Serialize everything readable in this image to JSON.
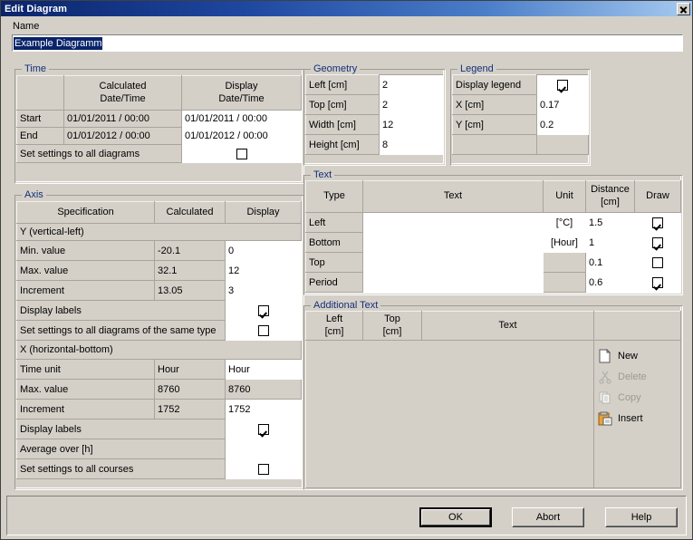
{
  "window": {
    "title": "Edit Diagram",
    "close_label": "✕"
  },
  "name": {
    "label": "Name",
    "value": "Example Diagramm"
  },
  "time": {
    "title": "Time",
    "headers": [
      "",
      "Calculated\nDate/Time",
      "Display\nDate/Time"
    ],
    "header_calculated_line1": "Calculated",
    "header_calculated_line2": "Date/Time",
    "header_display_line1": "Display",
    "header_display_line2": "Date/Time",
    "rows": [
      {
        "label": "Start",
        "calculated": "01/01/2011 / 00:00",
        "display": "01/01/2011 / 00:00"
      },
      {
        "label": "End",
        "calculated": "01/01/2012 / 00:00",
        "display": "01/01/2012 / 00:00"
      }
    ],
    "set_all_label": "Set settings to all diagrams",
    "set_all_checked": false
  },
  "axis": {
    "title": "Axis",
    "header_specification": "Specification",
    "header_calculated": "Calculated",
    "header_display": "Display",
    "y_section_label": "Y (vertical-left)",
    "y_rows": [
      {
        "label": "Min. value",
        "calculated": "-20.1",
        "display": "0"
      },
      {
        "label": "Max. value",
        "calculated": "32.1",
        "display": "12"
      },
      {
        "label": "Increment",
        "calculated": "13.05",
        "display": "3"
      }
    ],
    "y_display_labels_label": "Display labels",
    "y_display_labels_checked": true,
    "y_set_all_label": "Set settings to all diagrams of the same type",
    "y_set_all_checked": false,
    "x_section_label": "X (horizontal-bottom)",
    "x_rows": [
      {
        "label": "Time unit",
        "calculated": "Hour",
        "display": "Hour",
        "display_editable": true
      },
      {
        "label": "Max. value",
        "calculated": "8760",
        "display": "8760",
        "display_editable": false
      },
      {
        "label": "Increment",
        "calculated": "1752",
        "display": "1752",
        "display_editable": true
      }
    ],
    "x_display_labels_label": "Display labels",
    "x_display_labels_checked": true,
    "x_average_label": "Average over [h]",
    "x_average_value": "",
    "x_set_all_label": "Set settings to all courses",
    "x_set_all_checked": false
  },
  "geometry": {
    "title": "Geometry",
    "rows": [
      {
        "label": "Left  [cm]",
        "value": "2"
      },
      {
        "label": "Top  [cm]",
        "value": "2"
      },
      {
        "label": "Width  [cm]",
        "value": "12"
      },
      {
        "label": "Height  [cm]",
        "value": "8"
      }
    ]
  },
  "legend": {
    "title": "Legend",
    "display_legend_label": "Display legend",
    "display_legend_checked": true,
    "rows": [
      {
        "label": "X  [cm]",
        "value": "0.17"
      },
      {
        "label": "Y  [cm]",
        "value": "0.2"
      }
    ]
  },
  "text": {
    "title": "Text",
    "header_type": "Type",
    "header_text": "Text",
    "header_unit": "Unit",
    "header_distance_line1": "Distance",
    "header_distance_line2": "[cm]",
    "header_draw": "Draw",
    "rows": [
      {
        "type": "Left",
        "text": "",
        "unit": "[°C]",
        "unit_enabled": true,
        "distance": "1.5",
        "draw": true
      },
      {
        "type": "Bottom",
        "text": "",
        "unit": "[Hour]",
        "unit_enabled": true,
        "distance": "1",
        "draw": true
      },
      {
        "type": "Top",
        "text": "",
        "unit": "",
        "unit_enabled": false,
        "distance": "0.1",
        "draw": false
      },
      {
        "type": "Period",
        "text": "",
        "unit": "",
        "unit_enabled": false,
        "distance": "0.6",
        "draw": true
      }
    ]
  },
  "additional_text": {
    "title": "Additional Text",
    "header_left_line1": "Left",
    "header_left_line2": "[cm]",
    "header_top_line1": "Top",
    "header_top_line2": "[cm]",
    "header_text": "Text",
    "rows": [],
    "actions": [
      {
        "label": "New",
        "icon": "new-page-icon",
        "enabled": true
      },
      {
        "label": "Delete",
        "icon": "scissors-icon",
        "enabled": false
      },
      {
        "label": "Copy",
        "icon": "copy-pages-icon",
        "enabled": false
      },
      {
        "label": "Insert",
        "icon": "clipboard-paste-icon",
        "enabled": true
      }
    ]
  },
  "footer": {
    "ok_label": "OK",
    "abort_label": "Abort",
    "help_label": "Help"
  },
  "colors": {
    "dialog_face": "#d4d0c8",
    "group_title": "#14307a",
    "titlebar_start": "#0a246a",
    "titlebar_end": "#a6caf0",
    "selection": "#0a246a",
    "field_bg": "#ffffff"
  }
}
